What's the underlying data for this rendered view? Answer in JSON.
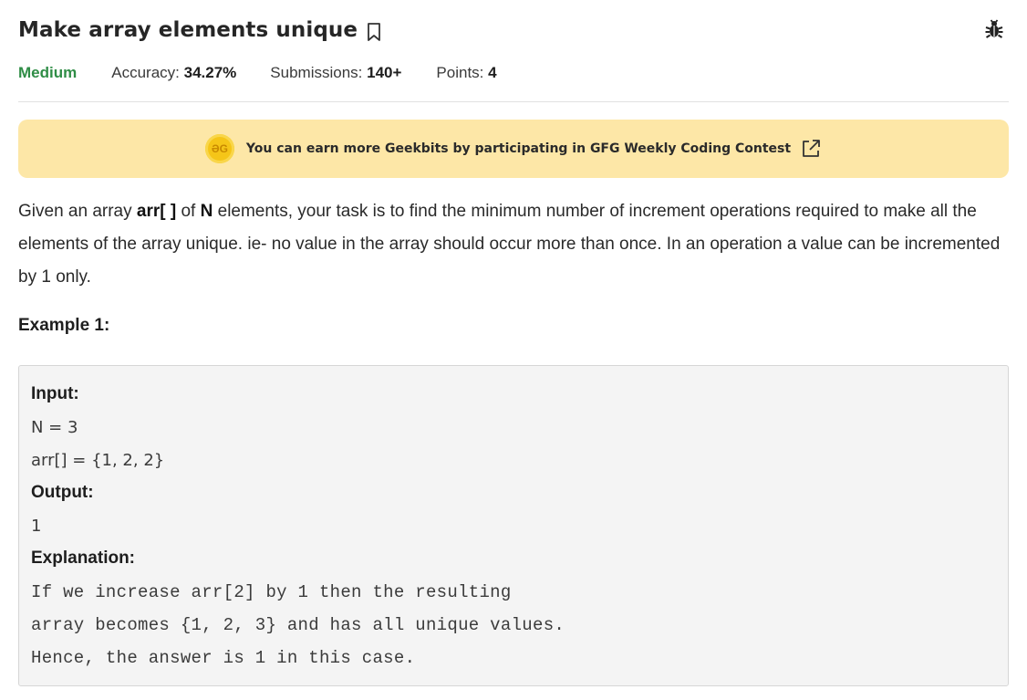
{
  "header": {
    "title": "Make array elements unique",
    "difficulty": "Medium",
    "accuracy_label": "Accuracy:",
    "accuracy_value": "34.27%",
    "submissions_label": "Submissions:",
    "submissions_value": "140+",
    "points_label": "Points:",
    "points_value": "4",
    "bookmark_icon": "bookmark-icon",
    "bug_icon": "bug-icon"
  },
  "banner": {
    "coin_text": "ƏG",
    "text": "You can earn more Geekbits by participating in GFG Weekly Coding Contest",
    "link_icon": "external-link-icon",
    "bg_color": "#fde7a7"
  },
  "description": {
    "p1_a": "Given an array ",
    "p1_arr": "arr[ ]",
    "p1_b": " of ",
    "p1_n": "N",
    "p1_c": " elements, your task is to find the minimum number of increment operations required to make all the elements of the array unique. ie- no value in the array should occur more than once. In an operation a value can be incremented by 1 only."
  },
  "example": {
    "heading": "Example 1:",
    "input_label": "Input:",
    "input_line1": "N = 3",
    "input_line2": "arr[] = {1, 2, 2}",
    "output_label": "Output:",
    "output_value": "1",
    "explanation_label": "Explanation:",
    "explanation_line1": "If we increase arr[2] by 1 then the resulting",
    "explanation_line2": "array becomes {1, 2, 3} and has all unique values.",
    "explanation_line3": "Hence, the answer is 1 in this case."
  },
  "colors": {
    "difficulty": "#2f8d46",
    "banner": "#fde7a7",
    "coin": "#f5c518"
  }
}
